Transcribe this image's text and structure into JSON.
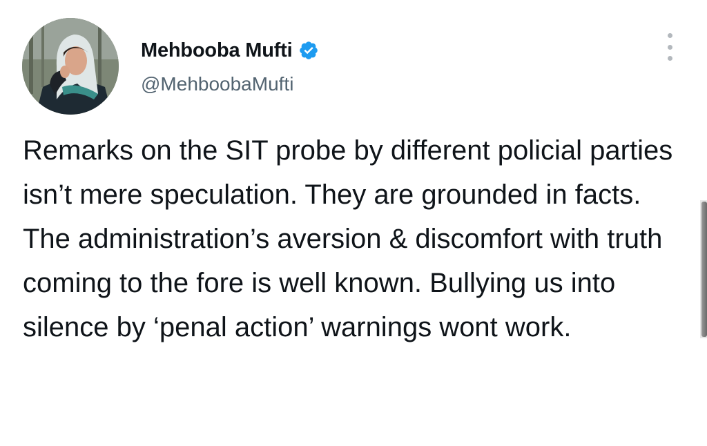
{
  "author": {
    "display_name": "Mehbooba Mufti",
    "handle": "@MehboobaMufti",
    "verified": true,
    "avatar_icon": "profile-photo"
  },
  "tweet": {
    "text": "Remarks on the SIT probe by different policial parties isn’t mere speculation. They are grounded in facts. The administration’s aversion & discomfort with truth coming to the fore is well known. Bullying us into silence by ‘penal action’ warnings wont work."
  },
  "icons": {
    "more": "more-vertical-icon",
    "verified": "verified-badge-icon"
  },
  "colors": {
    "text": "#0f1419",
    "secondary_text": "#536471",
    "verified_blue": "#1d9bf0",
    "background": "#ffffff"
  }
}
